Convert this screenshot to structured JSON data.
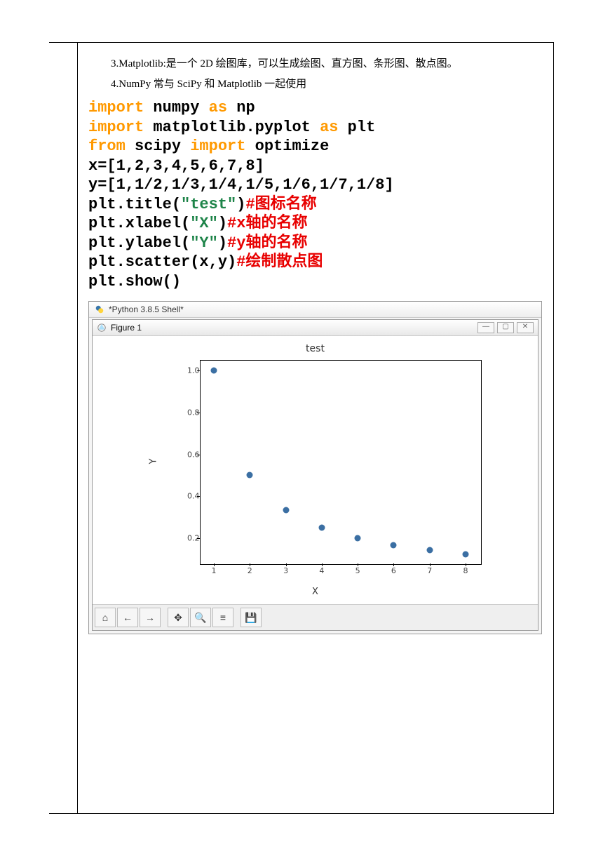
{
  "text": {
    "p1": "3.Matplotlib:是一个 2D 绘图库，可以生成绘图、直方图、条形图、散点图。",
    "p2": "4.NumPy 常与 SciPy 和 Matplotlib 一起使用"
  },
  "code": {
    "l1a": "import",
    "l1b": " numpy ",
    "l1c": "as",
    "l1d": " np",
    "l2a": "import",
    "l2b": " matplotlib.pyplot ",
    "l2c": "as",
    "l2d": " plt",
    "l3a": "from",
    "l3b": " scipy ",
    "l3c": "import",
    "l3d": " optimize",
    "l4": "x=[1,2,3,4,5,6,7,8]",
    "l5": "y=[1,1/2,1/3,1/4,1/5,1/6,1/7,1/8]",
    "l6a": "plt.title(",
    "l6s": "\"test\"",
    "l6b": ")",
    "l6c": "#图标名称",
    "l7a": "plt.xlabel(",
    "l7s": "\"X\"",
    "l7b": ")",
    "l7c": "#x轴的名称",
    "l8a": "plt.ylabel(",
    "l8s": "\"Y\"",
    "l8b": ")",
    "l8c": "#y轴的名称",
    "l9a": "plt.scatter(x,y)",
    "l9c": "#绘制散点图",
    "l10": "plt.show()"
  },
  "shell": {
    "title": "*Python 3.8.5 Shell*",
    "fig_title": "Figure 1",
    "win_min": "—",
    "win_max": "▢",
    "win_close": "✕"
  },
  "toolbar": {
    "home": "⌂",
    "back": "←",
    "fwd": "→",
    "pan": "✥",
    "zoom": "🔍",
    "conf": "≡",
    "save": "💾"
  },
  "chart_data": {
    "type": "scatter",
    "title": "test",
    "xlabel": "X",
    "ylabel": "Y",
    "x": [
      1,
      2,
      3,
      4,
      5,
      6,
      7,
      8
    ],
    "y": [
      1.0,
      0.5,
      0.333,
      0.25,
      0.2,
      0.167,
      0.143,
      0.125
    ],
    "xticks": [
      1,
      2,
      3,
      4,
      5,
      6,
      7,
      8
    ],
    "yticks": [
      0.2,
      0.4,
      0.6,
      0.8,
      1.0
    ],
    "xlim": [
      0.6,
      8.4
    ],
    "ylim": [
      0.08,
      1.05
    ]
  }
}
